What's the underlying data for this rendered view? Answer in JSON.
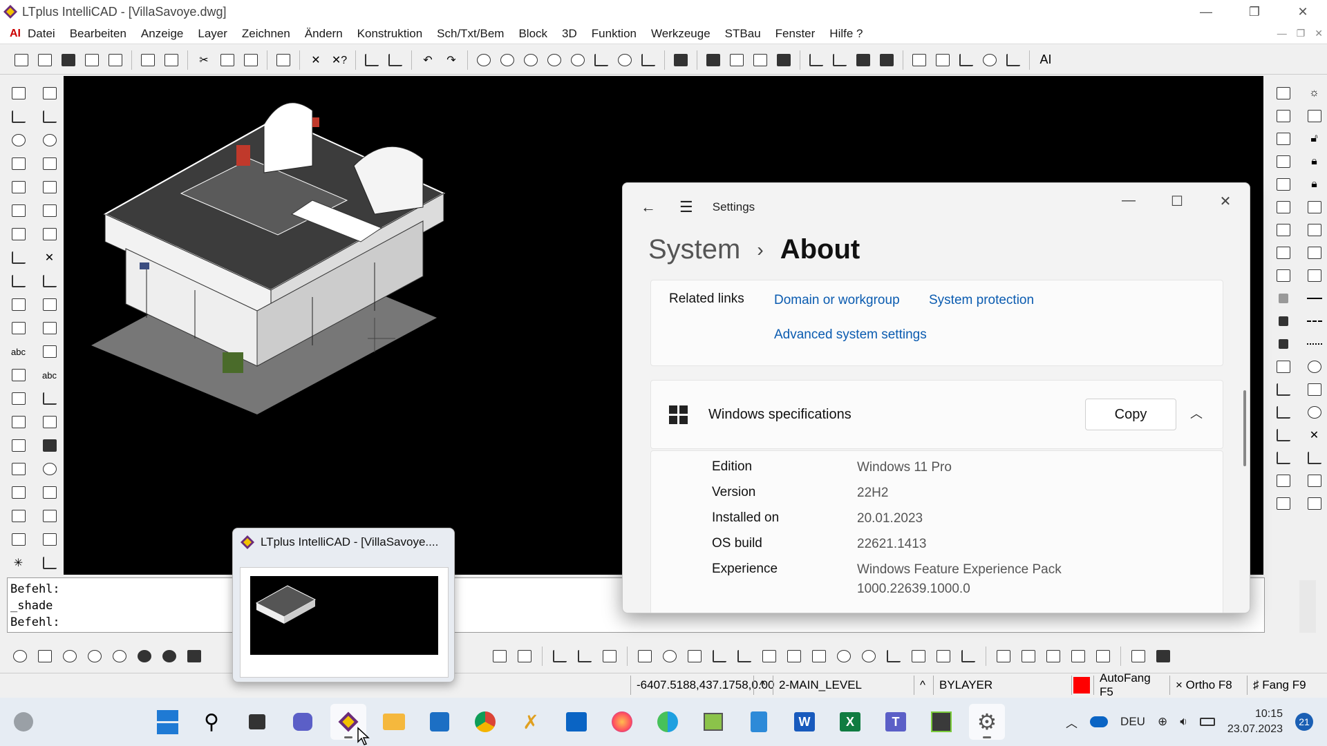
{
  "window": {
    "title": "LTplus IntelliCAD - [VillaSavoye.dwg]"
  },
  "menubar": {
    "logo": "AI",
    "items": [
      "Datei",
      "Bearbeiten",
      "Anzeige",
      "Layer",
      "Zeichnen",
      "Ändern",
      "Konstruktion",
      "Sch/Txt/Bem",
      "Block",
      "3D",
      "Funktion",
      "Werkzeuge",
      "STBau",
      "Fenster",
      "Hilfe ?"
    ]
  },
  "toolbar": {
    "ai_label": "AI"
  },
  "command_line": {
    "lines": [
      "Befehl:",
      "_shade",
      "Befehl:"
    ]
  },
  "statusbar": {
    "coords": "-6407.5188,437.1758,0.00",
    "layer": "2-MAIN_LEVEL",
    "linetype": "BYLAYER",
    "color_swatch": "#ff0000",
    "snap": "AutoFang F5",
    "ortho": "Ortho F8",
    "fang": "Fang F9"
  },
  "thumbnail": {
    "title": "LTplus IntelliCAD - [VillaSavoye...."
  },
  "settings": {
    "app_title": "Settings",
    "breadcrumb": [
      "System",
      "About"
    ],
    "related_links": {
      "label": "Related links",
      "links": [
        "Domain or workgroup",
        "System protection",
        "Advanced system settings"
      ]
    },
    "windows_spec": {
      "title": "Windows specifications",
      "copy_label": "Copy",
      "rows": [
        {
          "label": "Edition",
          "value": "Windows 11 Pro"
        },
        {
          "label": "Version",
          "value": "22H2"
        },
        {
          "label": "Installed on",
          "value": "20.01.2023"
        },
        {
          "label": "OS build",
          "value": "22621.1413"
        },
        {
          "label": "Experience",
          "value": "Windows Feature Experience Pack",
          "value2": "1000.22639.1000.0"
        }
      ]
    }
  },
  "taskbar": {
    "language": "DEU",
    "time": "10:15",
    "date": "23.07.2023",
    "notifications": "21"
  }
}
